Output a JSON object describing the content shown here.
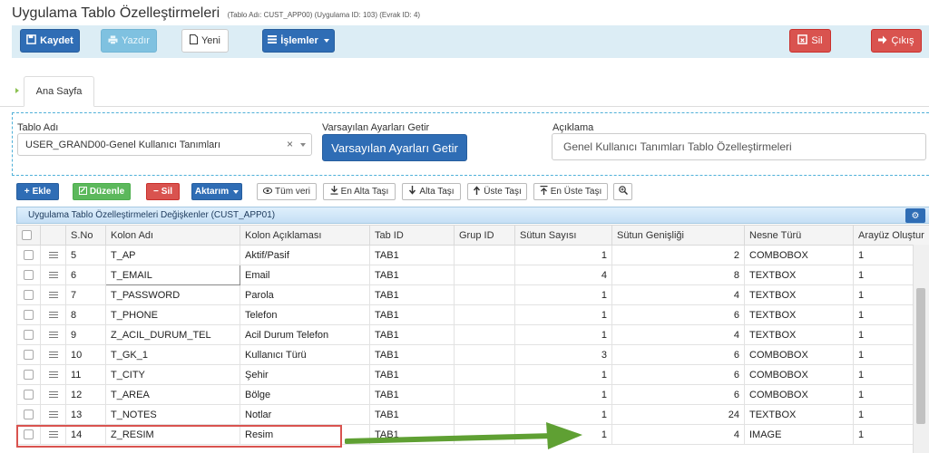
{
  "page": {
    "title": "Uygulama Tablo Özelleştirmeleri",
    "subtitle": "(Tablo Adı: CUST_APP00) (Uygulama ID: 103) (Evrak ID: 4)"
  },
  "toolbar": {
    "save": "Kaydet",
    "print": "Yazdır",
    "new": "Yeni",
    "actions": "İşlemler",
    "delete": "Sil",
    "exit": "Çıkış"
  },
  "tabs": [
    {
      "label": "Ana Sayfa"
    }
  ],
  "form": {
    "table_name_label": "Tablo Adı",
    "table_name_value": "USER_GRAND00-Genel Kullanıcı Tanımları",
    "defaults_label": "Varsayılan Ayarları Getir",
    "defaults_button": "Varsayılan Ayarları Getir",
    "description_label": "Açıklama",
    "description_value": "Genel Kullanıcı Tanımları Tablo Özelleştirmeleri"
  },
  "grid_toolbar": {
    "add": "Ekle",
    "edit": "Düzenle",
    "delete": "Sil",
    "export": "Aktarım",
    "all_data": "Tüm veri",
    "move_bottom": "En Alta Taşı",
    "move_down": "Alta Taşı",
    "move_up": "Üste Taşı",
    "move_top": "En Üste Taşı"
  },
  "grid": {
    "caption": "Uygulama Tablo Özelleştirmeleri Değişkenler (CUST_APP01)",
    "columns": [
      "",
      "",
      "S.No",
      "Kolon Adı",
      "Kolon Açıklaması",
      "Tab ID",
      "Grup ID",
      "Sütun Sayısı",
      "Sütun Genişliği",
      "Nesne Türü",
      "Arayüz Oluştur"
    ],
    "rows": [
      {
        "sno": "5",
        "name": "T_AP",
        "desc": "Aktif/Pasif",
        "tab": "TAB1",
        "group": "",
        "cols": "1",
        "width": "2",
        "type": "COMBOBOX",
        "ui": "1"
      },
      {
        "sno": "6",
        "name": "T_EMAIL",
        "desc": "Email",
        "tab": "TAB1",
        "group": "",
        "cols": "4",
        "width": "8",
        "type": "TEXTBOX",
        "ui": "1"
      },
      {
        "sno": "7",
        "name": "T_PASSWORD",
        "desc": "Parola",
        "tab": "TAB1",
        "group": "",
        "cols": "1",
        "width": "4",
        "type": "TEXTBOX",
        "ui": "1"
      },
      {
        "sno": "8",
        "name": "T_PHONE",
        "desc": "Telefon",
        "tab": "TAB1",
        "group": "",
        "cols": "1",
        "width": "6",
        "type": "TEXTBOX",
        "ui": "1"
      },
      {
        "sno": "9",
        "name": "Z_ACIL_DURUM_TEL",
        "desc": "Acil Durum Telefon",
        "tab": "TAB1",
        "group": "",
        "cols": "1",
        "width": "4",
        "type": "TEXTBOX",
        "ui": "1"
      },
      {
        "sno": "10",
        "name": "T_GK_1",
        "desc": "Kullanıcı Türü",
        "tab": "TAB1",
        "group": "",
        "cols": "3",
        "width": "6",
        "type": "COMBOBOX",
        "ui": "1"
      },
      {
        "sno": "11",
        "name": "T_CITY",
        "desc": "Şehir",
        "tab": "TAB1",
        "group": "",
        "cols": "1",
        "width": "6",
        "type": "COMBOBOX",
        "ui": "1"
      },
      {
        "sno": "12",
        "name": "T_AREA",
        "desc": "Bölge",
        "tab": "TAB1",
        "group": "",
        "cols": "1",
        "width": "6",
        "type": "COMBOBOX",
        "ui": "1"
      },
      {
        "sno": "13",
        "name": "T_NOTES",
        "desc": "Notlar",
        "tab": "TAB1",
        "group": "",
        "cols": "1",
        "width": "24",
        "type": "TEXTBOX",
        "ui": "1"
      },
      {
        "sno": "14",
        "name": "Z_RESIM",
        "desc": "Resim",
        "tab": "TAB1",
        "group": "",
        "cols": "1",
        "width": "4",
        "type": "IMAGE",
        "ui": "1"
      }
    ]
  },
  "colors": {
    "primary": "#2f6db5",
    "success": "#5cb85c",
    "danger": "#d9534f",
    "toolbar_bg": "#dcedf5",
    "highlight_border": "#d9534f",
    "arrow": "#5fa033"
  }
}
